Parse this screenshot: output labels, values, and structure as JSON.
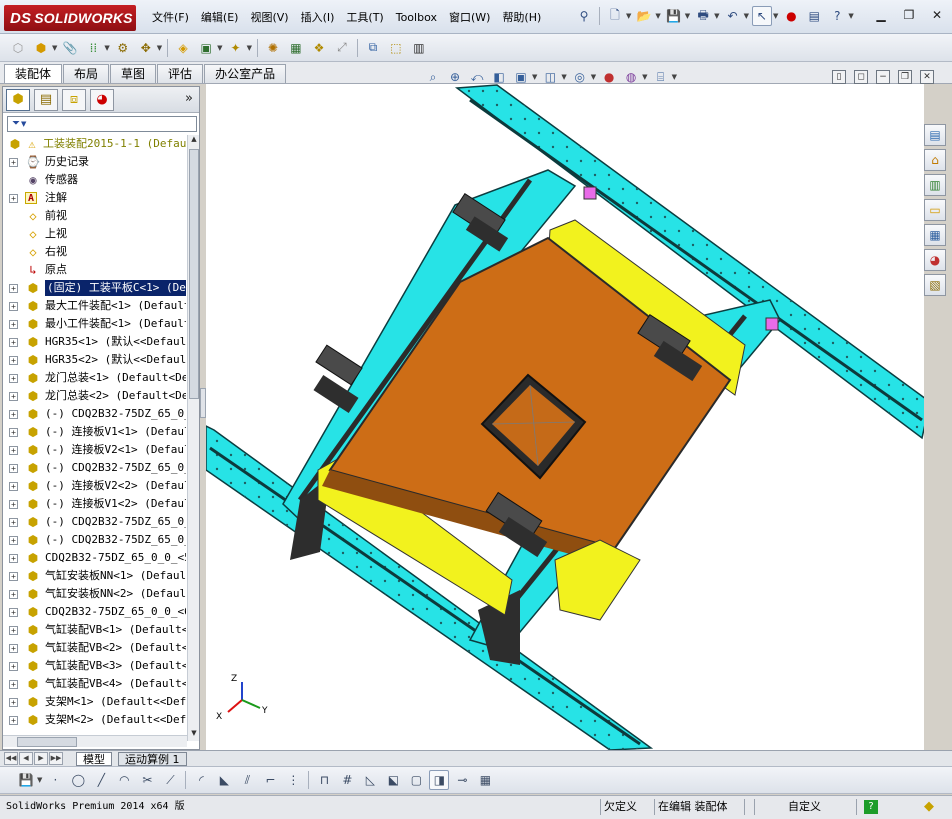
{
  "app": {
    "logo_text": "SOLIDWORKS",
    "logo_mark": "DS"
  },
  "menu": [
    "文件(F)",
    "编辑(E)",
    "视图(V)",
    "插入(I)",
    "工具(T)",
    "Toolbox",
    "窗口(W)",
    "帮助(H)"
  ],
  "command_tabs": [
    "装配体",
    "布局",
    "草图",
    "评估",
    "办公室产品"
  ],
  "feature_tree": {
    "filter_symbol": "▼",
    "items": [
      {
        "label": "工装装配2015-1-1  (Default",
        "icon": "assembly-warning-icon",
        "level": 0,
        "state": "warning"
      },
      {
        "label": "历史记录",
        "icon": "history-icon",
        "level": 1,
        "state": "normal"
      },
      {
        "label": "传感器",
        "icon": "sensor-icon",
        "level": 1,
        "state": "normal"
      },
      {
        "label": "注解",
        "icon": "annotation-icon",
        "level": 1,
        "state": "normal"
      },
      {
        "label": "前视",
        "icon": "plane-icon",
        "level": 1,
        "state": "normal"
      },
      {
        "label": "上视",
        "icon": "plane-icon",
        "level": 1,
        "state": "normal"
      },
      {
        "label": "右视",
        "icon": "plane-icon",
        "level": 1,
        "state": "normal"
      },
      {
        "label": "原点",
        "icon": "origin-icon",
        "level": 1,
        "state": "normal"
      },
      {
        "label": "(固定) 工装平板C<1> (Def",
        "icon": "part-icon",
        "level": 1,
        "state": "selected"
      },
      {
        "label": "最大工件装配<1> (Default",
        "icon": "part-icon",
        "level": 1,
        "state": "normal"
      },
      {
        "label": "最小工件装配<1> (Default",
        "icon": "part-icon",
        "level": 1,
        "state": "normal"
      },
      {
        "label": "HGR35<1> (默认<<Default",
        "icon": "part-icon",
        "level": 1,
        "state": "normal"
      },
      {
        "label": "HGR35<2> (默认<<Default",
        "icon": "part-icon",
        "level": 1,
        "state": "normal"
      },
      {
        "label": "龙门总装<1> (Default<De",
        "icon": "part-icon",
        "level": 1,
        "state": "normal"
      },
      {
        "label": "龙门总装<2> (Default<De",
        "icon": "part-icon",
        "level": 1,
        "state": "normal"
      },
      {
        "label": "(-) CDQ2B32-75DZ_65_0_0",
        "icon": "part-icon",
        "level": 1,
        "state": "normal"
      },
      {
        "label": "(-) 连接板V1<1> (Default",
        "icon": "part-icon",
        "level": 1,
        "state": "normal"
      },
      {
        "label": "(-) 连接板V2<1> (Default",
        "icon": "part-icon",
        "level": 1,
        "state": "normal"
      },
      {
        "label": "(-) CDQ2B32-75DZ_65_0_0",
        "icon": "part-icon",
        "level": 1,
        "state": "normal"
      },
      {
        "label": "(-) 连接板V2<2> (Default",
        "icon": "part-icon",
        "level": 1,
        "state": "normal"
      },
      {
        "label": "(-) 连接板V1<2> (Default",
        "icon": "part-icon",
        "level": 1,
        "state": "normal"
      },
      {
        "label": "(-) CDQ2B32-75DZ_65_0_0",
        "icon": "part-icon",
        "level": 1,
        "state": "normal"
      },
      {
        "label": "(-) CDQ2B32-75DZ_65_0_0",
        "icon": "part-icon",
        "level": 1,
        "state": "normal"
      },
      {
        "label": "CDQ2B32-75DZ_65_0_0_<5>",
        "icon": "part-icon",
        "level": 1,
        "state": "normal"
      },
      {
        "label": "气缸安装板NN<1> (Default",
        "icon": "part-icon",
        "level": 1,
        "state": "normal"
      },
      {
        "label": "气缸安装板NN<2> (Default",
        "icon": "part-icon",
        "level": 1,
        "state": "normal"
      },
      {
        "label": "CDQ2B32-75DZ_65_0_0_<6>",
        "icon": "part-icon",
        "level": 1,
        "state": "normal"
      },
      {
        "label": "气缸装配VB<1> (Default<",
        "icon": "part-icon",
        "level": 1,
        "state": "normal"
      },
      {
        "label": "气缸装配VB<2> (Default<",
        "icon": "part-icon",
        "level": 1,
        "state": "normal"
      },
      {
        "label": "气缸装配VB<3> (Default<",
        "icon": "part-icon",
        "level": 1,
        "state": "normal"
      },
      {
        "label": "气缸装配VB<4> (Default<",
        "icon": "part-icon",
        "level": 1,
        "state": "normal"
      },
      {
        "label": "支架M<1> (Default<<Defau",
        "icon": "part-icon",
        "level": 1,
        "state": "normal"
      },
      {
        "label": "支架M<2> (Default<<Defau",
        "icon": "part-icon",
        "level": 1,
        "state": "normal"
      }
    ]
  },
  "model_tabs": [
    "模型",
    "运动算例 1"
  ],
  "triad": {
    "x": "X",
    "y": "Y",
    "z": "Z"
  },
  "status": {
    "app_version": "SolidWorks Premium 2014 x64 版",
    "underdefined": "欠定义",
    "editing": "在编辑 装配体",
    "units": "自定义",
    "help": "?"
  },
  "colors": {
    "rail": "#28e8e8",
    "plate": "#c96a14",
    "yellow_part": "#f2f21e",
    "frame": "#3a3a3a",
    "selection": "#0a246a",
    "logo": "#b7171b"
  }
}
